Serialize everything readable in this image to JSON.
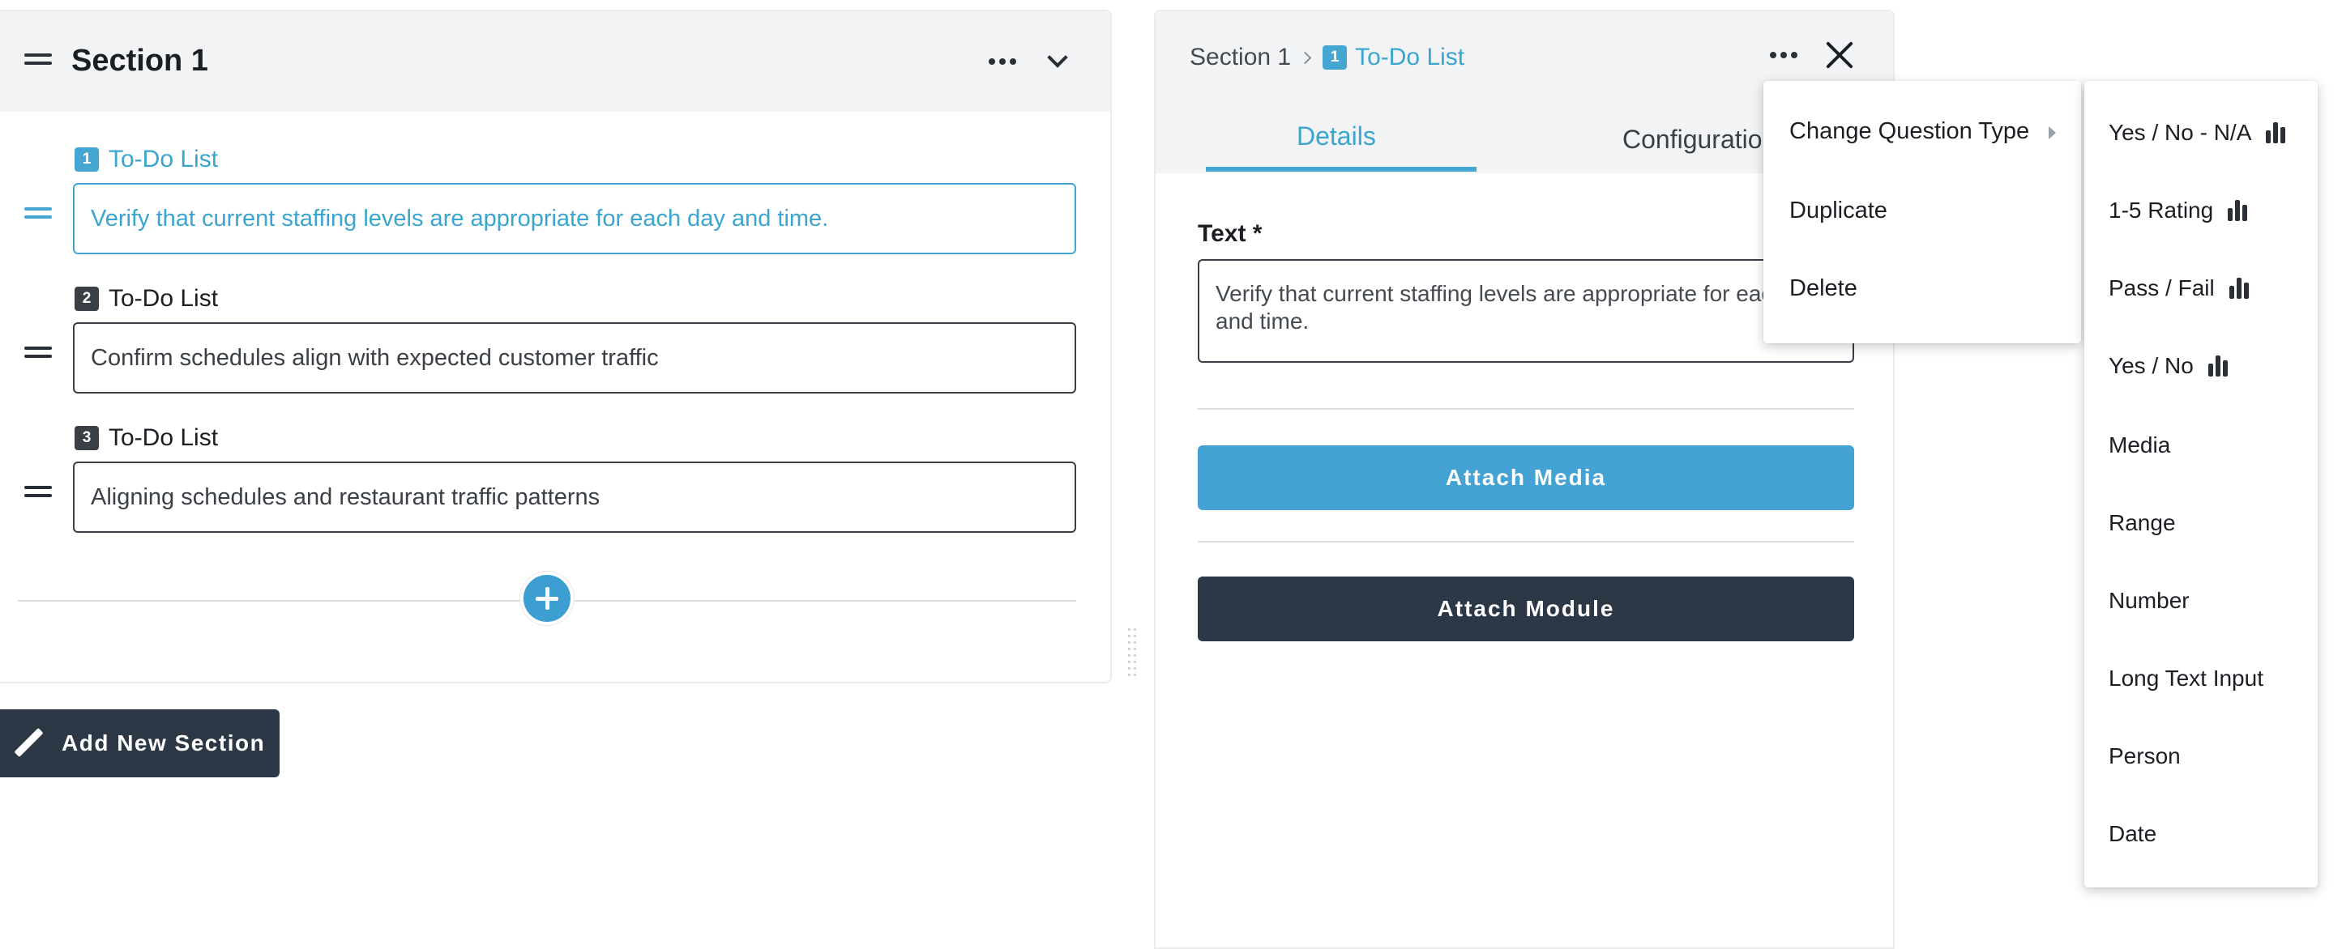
{
  "section": {
    "title": "Section 1",
    "questions": [
      {
        "number": "1",
        "label": "To-Do List",
        "text": "Verify that current staffing levels are appropriate for each day and time.",
        "active": true
      },
      {
        "number": "2",
        "label": "To-Do List",
        "text": "Confirm schedules align with expected customer traffic",
        "active": false
      },
      {
        "number": "3",
        "label": "To-Do List",
        "text": "Aligning schedules and restaurant traffic patterns",
        "active": false
      }
    ],
    "add_section_label": "Add New Section"
  },
  "detail": {
    "breadcrumb": {
      "section": "Section 1",
      "badge": "1",
      "current": "To-Do List"
    },
    "tabs": [
      {
        "label": "Details"
      },
      {
        "label": "Configuratio"
      }
    ],
    "text_label": "Text *",
    "text_value": "Verify that current staffing levels are appropriate for each day and time.",
    "attach_media_label": "Attach Media",
    "attach_module_label": "Attach Module"
  },
  "context_menu": {
    "items": [
      {
        "label": "Change Question Type"
      },
      {
        "label": "Duplicate"
      },
      {
        "label": "Delete"
      }
    ]
  },
  "type_menu": {
    "items": [
      {
        "label": "Yes / No - N/A",
        "icon": "bar-chart-icon"
      },
      {
        "label": "1-5 Rating",
        "icon": "bar-chart-icon"
      },
      {
        "label": "Pass / Fail",
        "icon": "bar-chart-icon"
      },
      {
        "label": "Yes / No",
        "icon": "bar-chart-icon"
      },
      {
        "label": "Media"
      },
      {
        "label": "Range"
      },
      {
        "label": "Number"
      },
      {
        "label": "Long Text Input"
      },
      {
        "label": "Person"
      },
      {
        "label": "Date"
      }
    ]
  },
  "colors": {
    "accent": "#45a6d2",
    "dark": "#2d3846",
    "header_bg": "#f2f3f5"
  }
}
